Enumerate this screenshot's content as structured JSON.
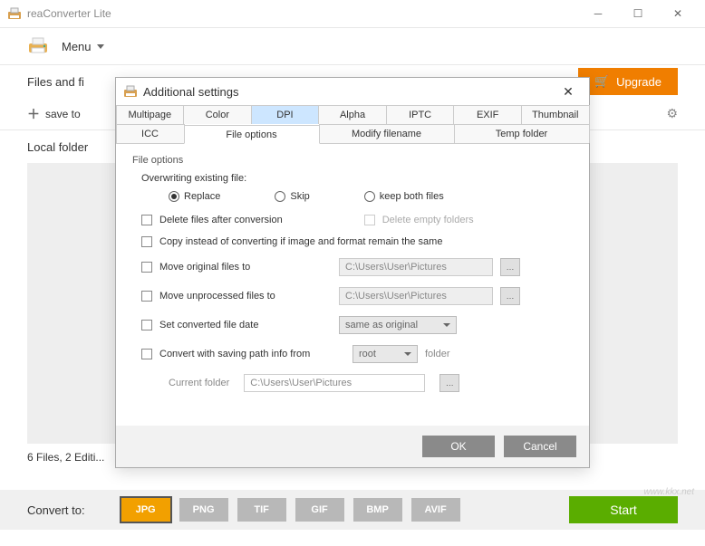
{
  "app_title": "reaConverter Lite",
  "menu_label": "Menu",
  "files_label": "Files and fi",
  "upgrade_label": "Upgrade",
  "save_to_label": "save to",
  "local_folder_label": "Local folder",
  "status_text": "6 Files, 2 Editi...",
  "convert_to_label": "Convert to:",
  "formats": [
    "JPG",
    "PNG",
    "TIF",
    "GIF",
    "BMP",
    "AVIF"
  ],
  "start_label": "Start",
  "dialog": {
    "title": "Additional settings",
    "tabs_row1": [
      "Multipage",
      "Color",
      "DPI",
      "Alpha",
      "IPTC",
      "EXIF",
      "Thumbnail"
    ],
    "tabs_row2": [
      "ICC",
      "File options",
      "Modify filename",
      "Temp folder"
    ],
    "group_title": "File options",
    "overwrite_label": "Overwriting existing file:",
    "radios": {
      "replace": "Replace",
      "skip": "Skip",
      "keep": "keep both files"
    },
    "delete_files": "Delete files after conversion",
    "delete_empty": "Delete empty folders",
    "copy_instead": "Copy instead of converting if image and format remain the same",
    "move_orig": "Move original files to",
    "move_unproc": "Move unprocessed files to",
    "set_date": "Set converted file date",
    "date_opt": "same as original",
    "convert_path": "Convert with saving path info from",
    "root_opt": "root",
    "folder_lbl": "folder",
    "current_folder": "Current folder",
    "path1": "C:\\Users\\User\\Pictures",
    "path2": "C:\\Users\\User\\Pictures",
    "path3": "C:\\Users\\User\\Pictures",
    "ok": "OK",
    "cancel": "Cancel"
  },
  "watermark": "www.kkx.net"
}
